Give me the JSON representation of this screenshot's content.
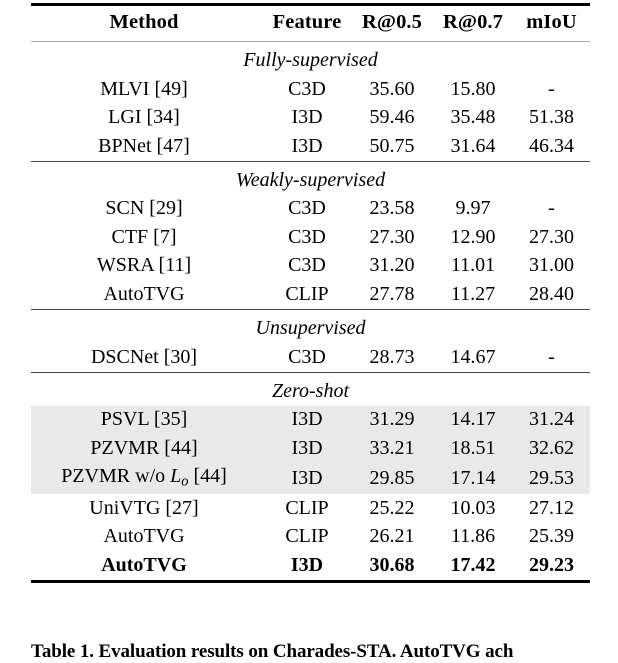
{
  "table": {
    "columns": [
      "Method",
      "Feature",
      "R@0.5",
      "R@0.7",
      "mIoU"
    ],
    "sections": [
      {
        "label": "Fully-supervised",
        "rows": [
          {
            "method": "MLVI [49]",
            "feature": "C3D",
            "r05": "35.60",
            "r07": "15.80",
            "miou": "-",
            "shaded": false,
            "bold": false
          },
          {
            "method": "LGI [34]",
            "feature": "I3D",
            "r05": "59.46",
            "r07": "35.48",
            "miou": "51.38",
            "shaded": false,
            "bold": false
          },
          {
            "method": "BPNet [47]",
            "feature": "I3D",
            "r05": "50.75",
            "r07": "31.64",
            "miou": "46.34",
            "shaded": false,
            "bold": false
          }
        ]
      },
      {
        "label": "Weakly-supervised",
        "rows": [
          {
            "method": "SCN [29]",
            "feature": "C3D",
            "r05": "23.58",
            "r07": "9.97",
            "miou": "-",
            "shaded": false,
            "bold": false
          },
          {
            "method": "CTF [7]",
            "feature": "C3D",
            "r05": "27.30",
            "r07": "12.90",
            "miou": "27.30",
            "shaded": false,
            "bold": false
          },
          {
            "method": "WSRA [11]",
            "feature": "C3D",
            "r05": "31.20",
            "r07": "11.01",
            "miou": "31.00",
            "shaded": false,
            "bold": false
          },
          {
            "method": "AutoTVG",
            "feature": "CLIP",
            "r05": "27.78",
            "r07": "11.27",
            "miou": "28.40",
            "shaded": false,
            "bold": false
          }
        ]
      },
      {
        "label": "Unsupervised",
        "rows": [
          {
            "method": "DSCNet [30]",
            "feature": "C3D",
            "r05": "28.73",
            "r07": "14.67",
            "miou": "-",
            "shaded": false,
            "bold": false
          }
        ]
      },
      {
        "label": "Zero-shot",
        "rows": [
          {
            "method": "PSVL [35]",
            "feature": "I3D",
            "r05": "31.29",
            "r07": "14.17",
            "miou": "31.24",
            "shaded": true,
            "bold": false
          },
          {
            "method": "PZVMR [44]",
            "feature": "I3D",
            "r05": "33.21",
            "r07": "18.51",
            "miou": "32.62",
            "shaded": true,
            "bold": false
          },
          {
            "method": "PZVMR w/o Lo [44]",
            "method_html": "PZVMR w/o <span class=\"mathit\">L</span><span class=\"sub\">o</span> [44]",
            "feature": "I3D",
            "r05": "29.85",
            "r07": "17.14",
            "miou": "29.53",
            "shaded": true,
            "bold": false
          },
          {
            "method": "UniVTG [27]",
            "feature": "CLIP",
            "r05": "25.22",
            "r07": "10.03",
            "miou": "27.12",
            "shaded": false,
            "bold": false
          },
          {
            "method": "AutoTVG",
            "feature": "CLIP",
            "r05": "26.21",
            "r07": "11.86",
            "miou": "25.39",
            "shaded": false,
            "bold": false
          },
          {
            "method": "AutoTVG",
            "feature": "I3D",
            "r05": "30.68",
            "r07": "17.42",
            "miou": "29.23",
            "shaded": false,
            "bold": true
          }
        ]
      }
    ]
  },
  "caption": {
    "text": "Table 1. Evaluation results on Charades-STA. AutoTVG ach"
  }
}
